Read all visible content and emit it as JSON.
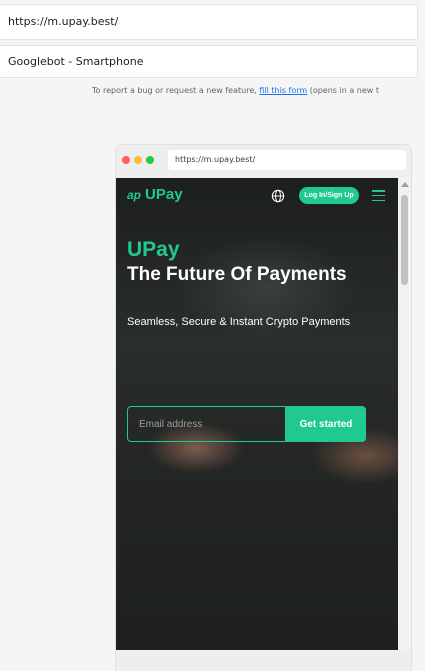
{
  "tool": {
    "url_value": "https://m.upay.best/",
    "user_agent": "Googlebot - Smartphone",
    "report_text_before": "To report a bug or request a new feature, ",
    "report_link": "fill this form",
    "report_text_after": " (opens in a new t"
  },
  "preview": {
    "address_bar": "https://m.upay.best/",
    "nav": {
      "logo_mark": "ap",
      "logo_text": "UPay",
      "globe_icon": "globe-icon",
      "login_label": "Log In/Sign Up",
      "menu_icon": "hamburger-menu-icon"
    },
    "hero": {
      "brand": "UPay",
      "title": "The Future Of Payments",
      "subtitle": "Seamless, Secure & Instant Crypto Payments",
      "email_placeholder": "Email address",
      "cta_label": "Get started"
    }
  },
  "colors": {
    "brand_green": "#1fc98f",
    "hero_bg": "#232624",
    "link_blue": "#1a73e8"
  }
}
